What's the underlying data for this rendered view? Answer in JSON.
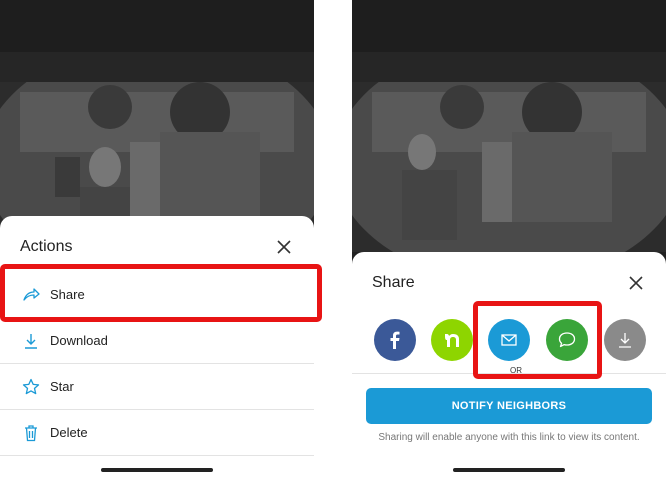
{
  "left": {
    "sheet_title": "Actions",
    "actions": [
      {
        "label": "Share",
        "icon": "share-arrow-icon"
      },
      {
        "label": "Download",
        "icon": "download-icon"
      },
      {
        "label": "Star",
        "icon": "star-icon"
      },
      {
        "label": "Delete",
        "icon": "trash-icon"
      }
    ]
  },
  "right": {
    "sheet_title": "Share",
    "share_options": [
      {
        "name": "facebook",
        "icon": "facebook-icon",
        "color": "#3b5998"
      },
      {
        "name": "nextdoor",
        "icon": "nextdoor-icon",
        "color": "#8ed500"
      },
      {
        "name": "email",
        "icon": "mail-icon",
        "color": "#1b9ad6"
      },
      {
        "name": "message",
        "icon": "chat-bubble-icon",
        "color": "#3aa53a"
      },
      {
        "name": "download",
        "icon": "download-icon",
        "color": "#8a8a8a"
      }
    ],
    "or_label": "OR",
    "notify_label": "NOTIFY NEIGHBORS",
    "note": "Sharing will enable anyone with this link to view its content."
  },
  "colors": {
    "accent": "#1b9ad6",
    "highlight": "#e81414",
    "icon_blue": "#1b9ad6"
  }
}
